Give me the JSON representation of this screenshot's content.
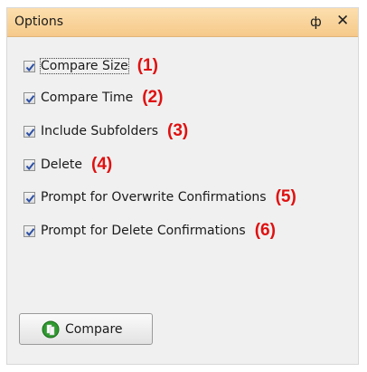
{
  "panel": {
    "title": "Options",
    "pin_glyph": "ф",
    "close_glyph": "✕"
  },
  "options": [
    {
      "label": "Compare Size",
      "checked": true,
      "number": "(1)"
    },
    {
      "label": "Compare Time",
      "checked": true,
      "number": "(2)"
    },
    {
      "label": "Include Subfolders",
      "checked": true,
      "number": "(3)"
    },
    {
      "label": "Delete",
      "checked": true,
      "number": "(4)"
    },
    {
      "label": "Prompt for Overwrite Confirmations",
      "checked": true,
      "number": "(5)"
    },
    {
      "label": "Prompt for Delete Confirmations",
      "checked": true,
      "number": "(6)"
    }
  ],
  "compare_button": {
    "label": "Compare",
    "icon": "compare-icon"
  },
  "colors": {
    "title_bar": "#f6c98a",
    "panel_bg": "#f0f0f0",
    "annotation": "#e01010",
    "check": "#2b4fa6"
  }
}
